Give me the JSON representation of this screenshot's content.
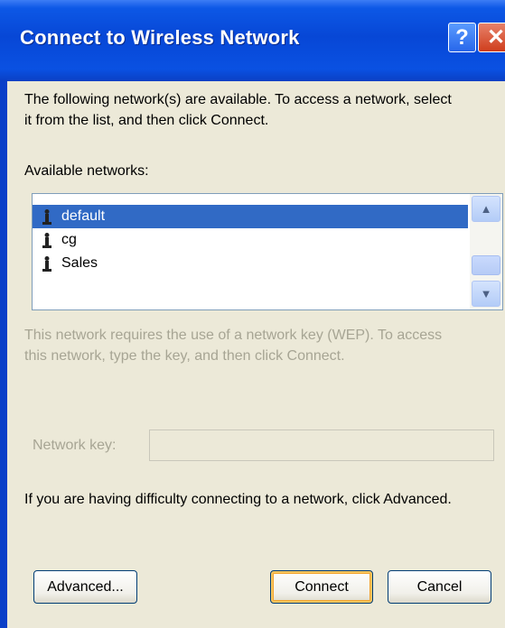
{
  "window": {
    "title": "Connect to Wireless Network",
    "help_icon": "help-icon",
    "close_icon": "close-icon"
  },
  "intro_text_line1": "The following network(s) are available. To access a network, select",
  "intro_text_line2": "it from the list, and then click Connect.",
  "available_label": "Available networks:",
  "networks": [
    {
      "name": "default",
      "icon": "wireless-antenna-icon",
      "selected": true
    },
    {
      "name": "cg",
      "icon": "wireless-antenna-icon",
      "selected": false
    },
    {
      "name": "Sales",
      "icon": "wireless-antenna-icon",
      "selected": false
    }
  ],
  "wep_text_line1": "This network requires the use of a network key (WEP). To access",
  "wep_text_line2": "this network, type the key, and then click Connect.",
  "network_key": {
    "label": "Network key:",
    "value": ""
  },
  "advanced_hint": "If you are having difficulty connecting to a network, click Advanced.",
  "buttons": {
    "advanced": "Advanced...",
    "connect": "Connect",
    "cancel": "Cancel"
  },
  "colors": {
    "title_bar": "#0a51e2",
    "selection": "#316ac5",
    "face": "#ece9d8",
    "disabled_text": "#a7a594"
  }
}
